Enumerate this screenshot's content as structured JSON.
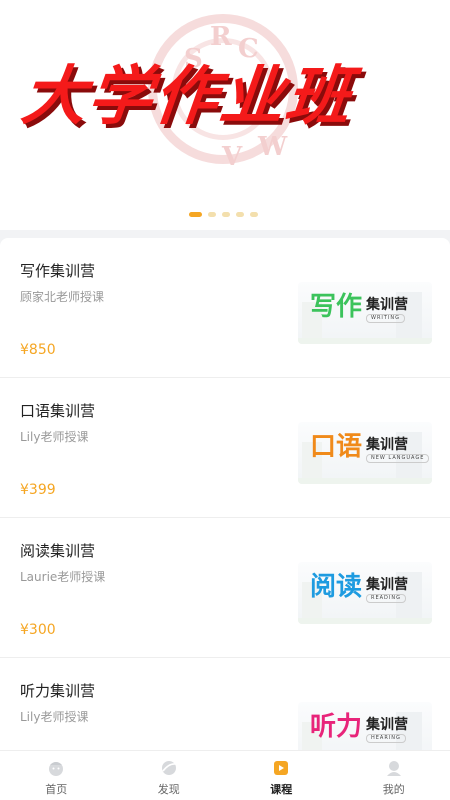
{
  "banner": {
    "title": "大学作业班",
    "seal_letters": [
      "S",
      "R",
      "C",
      "W",
      "V"
    ],
    "slides": 5,
    "active_slide": 0
  },
  "courses": [
    {
      "title": "写作集训营",
      "teacher": "顾家北老师授课",
      "price": "¥850",
      "thumb": {
        "big": "写作",
        "small": "集训营",
        "sub": "WRITING",
        "color": "#3cc35c"
      }
    },
    {
      "title": "口语集训营",
      "teacher": "Lily老师授课",
      "price": "¥399",
      "thumb": {
        "big": "口语",
        "small": "集训营",
        "sub": "NEW LANGUAGE",
        "color": "#f08a1a"
      }
    },
    {
      "title": "阅读集训营",
      "teacher": "Laurie老师授课",
      "price": "¥300",
      "thumb": {
        "big": "阅读",
        "small": "集训营",
        "sub": "READING",
        "color": "#1e9be0"
      }
    },
    {
      "title": "听力集训营",
      "teacher": "Lily老师授课",
      "price": "",
      "thumb": {
        "big": "听力",
        "small": "集训营",
        "sub": "HEARING",
        "color": "#e8247a"
      }
    }
  ],
  "tabs": [
    {
      "label": "首页",
      "icon": "home-icon"
    },
    {
      "label": "发现",
      "icon": "discover-icon"
    },
    {
      "label": "课程",
      "icon": "course-icon",
      "active": true
    },
    {
      "label": "我的",
      "icon": "profile-icon"
    }
  ],
  "colors": {
    "accent": "#f5a623",
    "price": "#f5a623",
    "banner_red": "#f41a1a"
  }
}
